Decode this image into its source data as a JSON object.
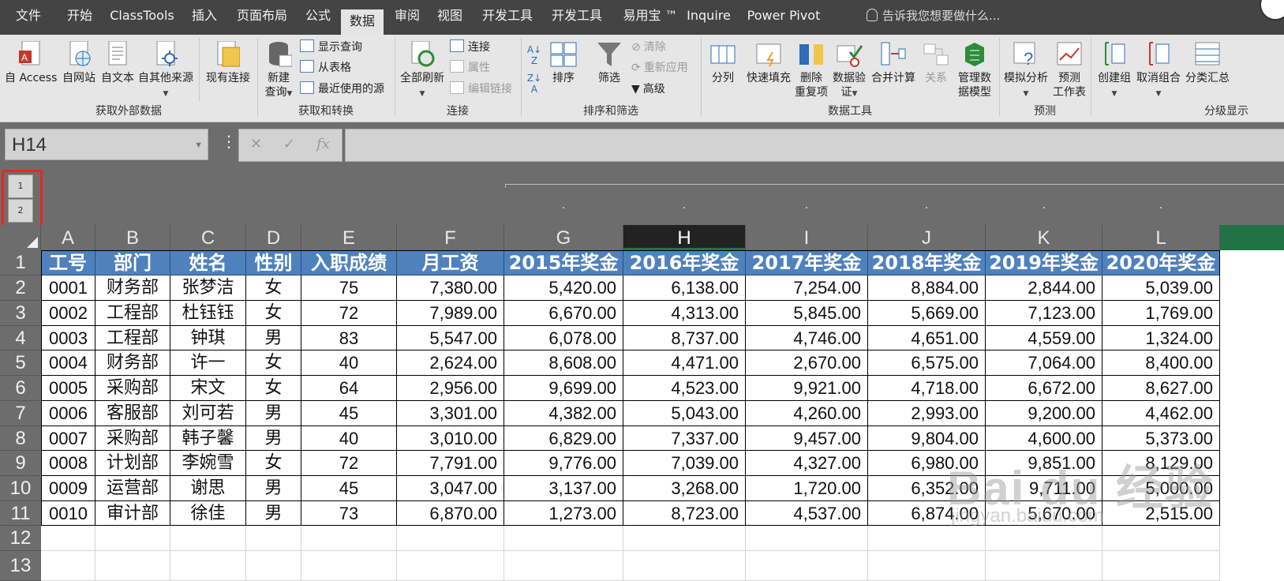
{
  "tabs": [
    "文件",
    "开始",
    "ClassTools",
    "插入",
    "页面布局",
    "公式",
    "数据",
    "审阅",
    "视图",
    "开发工具",
    "开发工具",
    "易用宝 ™",
    "Inquire",
    "Power Pivot"
  ],
  "active_tab": "数据",
  "tell_me": "告诉我您想要做什么...",
  "ribbon": {
    "get_external": {
      "label": "获取外部数据",
      "from_access": "自 Access",
      "from_web": "自网站",
      "from_text": "自文本",
      "from_other": "自其他来源",
      "existing": "现有连接"
    },
    "get_transform": {
      "label": "获取和转换",
      "new_query_1": "新建",
      "new_query_2": "查询",
      "show_queries": "显示查询",
      "from_table": "从表格",
      "recent_sources": "最近使用的源"
    },
    "connections": {
      "label": "连接",
      "refresh_all": "全部刷新",
      "connections": "连接",
      "properties": "属性",
      "edit_links": "编辑链接"
    },
    "sort_filter": {
      "label": "排序和筛选",
      "sort": "排序",
      "filter": "筛选",
      "clear": "清除",
      "reapply": "重新应用",
      "advanced": "高级"
    },
    "data_tools": {
      "label": "数据工具",
      "text_to_columns": "分列",
      "flash_fill": "快速填充",
      "remove_dup_1": "删除",
      "remove_dup_2": "重复项",
      "validation_1": "数据验",
      "validation_2": "证",
      "consolidate": "合并计算",
      "relationships": "关系",
      "manage_model_1": "管理数",
      "manage_model_2": "据模型"
    },
    "forecast": {
      "label": "预测",
      "what_if": "模拟分析",
      "forecast_sheet_1": "预测",
      "forecast_sheet_2": "工作表"
    },
    "outline": {
      "label": "分级显示",
      "group": "创建组",
      "ungroup": "取消组合",
      "subtotal": "分类汇总"
    }
  },
  "name_box": "H14",
  "outline_levels": [
    "1",
    "2"
  ],
  "columns": [
    "A",
    "B",
    "C",
    "D",
    "E",
    "F",
    "G",
    "H",
    "I",
    "J",
    "K",
    "L"
  ],
  "selected_column": "H",
  "rows": [
    "1",
    "2",
    "3",
    "4",
    "5",
    "6",
    "7",
    "8",
    "9",
    "10",
    "11",
    "12",
    "13"
  ],
  "table": {
    "headers": [
      "工号",
      "部门",
      "姓名",
      "性别",
      "入职成绩",
      "月工资",
      "2015年奖金",
      "2016年奖金",
      "2017年奖金",
      "2018年奖金",
      "2019年奖金",
      "2020年奖金"
    ],
    "data": [
      [
        "0001",
        "财务部",
        "张梦洁",
        "女",
        "75",
        "7,380.00",
        "5,420.00",
        "6,138.00",
        "7,254.00",
        "8,884.00",
        "2,844.00",
        "5,039.00"
      ],
      [
        "0002",
        "工程部",
        "杜钰钰",
        "女",
        "72",
        "7,989.00",
        "6,670.00",
        "4,313.00",
        "5,845.00",
        "5,669.00",
        "7,123.00",
        "1,769.00"
      ],
      [
        "0003",
        "工程部",
        "钟琪",
        "男",
        "83",
        "5,547.00",
        "6,078.00",
        "8,737.00",
        "4,746.00",
        "4,651.00",
        "4,559.00",
        "1,324.00"
      ],
      [
        "0004",
        "财务部",
        "许一",
        "女",
        "40",
        "2,624.00",
        "8,608.00",
        "4,471.00",
        "2,670.00",
        "6,575.00",
        "7,064.00",
        "8,400.00"
      ],
      [
        "0005",
        "采购部",
        "宋文",
        "女",
        "64",
        "2,956.00",
        "9,699.00",
        "4,523.00",
        "9,921.00",
        "4,718.00",
        "6,672.00",
        "8,627.00"
      ],
      [
        "0006",
        "客服部",
        "刘可若",
        "男",
        "45",
        "3,301.00",
        "4,382.00",
        "5,043.00",
        "4,260.00",
        "2,993.00",
        "9,200.00",
        "4,462.00"
      ],
      [
        "0007",
        "采购部",
        "韩子馨",
        "男",
        "40",
        "3,010.00",
        "6,829.00",
        "7,337.00",
        "9,457.00",
        "9,804.00",
        "4,600.00",
        "5,373.00"
      ],
      [
        "0008",
        "计划部",
        "李婉雪",
        "女",
        "72",
        "7,791.00",
        "9,776.00",
        "7,039.00",
        "4,327.00",
        "6,980.00",
        "9,851.00",
        "8,129.00"
      ],
      [
        "0009",
        "运营部",
        "谢思",
        "男",
        "45",
        "3,047.00",
        "3,137.00",
        "3,268.00",
        "1,720.00",
        "6,352.00",
        "9,711.00",
        "5,000.00"
      ],
      [
        "0010",
        "审计部",
        "徐佳",
        "男",
        "73",
        "6,870.00",
        "1,273.00",
        "8,723.00",
        "4,537.00",
        "6,874.00",
        "5,670.00",
        "2,515.00"
      ]
    ]
  },
  "watermark": {
    "line1": "Bai du 经验",
    "line2": "jingyan.baidu.com"
  }
}
